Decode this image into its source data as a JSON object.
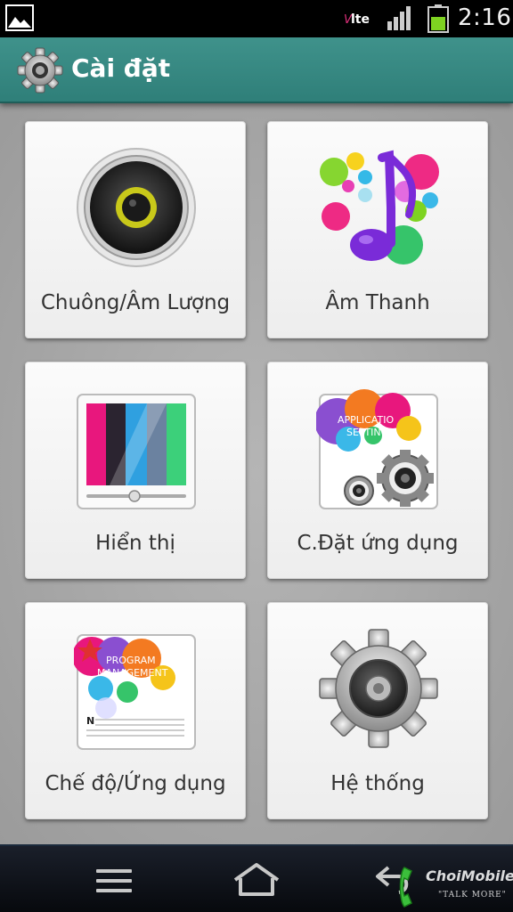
{
  "status_bar": {
    "network_badge": "Volte",
    "time": "2:16",
    "icons": [
      "gallery-icon",
      "volte-icon",
      "signal-icon",
      "battery-icon"
    ]
  },
  "header": {
    "title": "Cài đặt",
    "icon": "settings-gear-icon"
  },
  "tiles": [
    {
      "label": "Chuông/Âm Lượng",
      "icon": "speaker-icon"
    },
    {
      "label": "Âm Thanh",
      "icon": "music-note-icon"
    },
    {
      "label": "Hiển thị",
      "icon": "display-icon"
    },
    {
      "label": "C.Đặt ứng dụng",
      "icon": "application-settings-icon",
      "icon_text": "APPLICATION SETTINGS"
    },
    {
      "label": "Chế độ/Ứng dụng",
      "icon": "program-management-icon",
      "icon_text": "PROGRAM MANAGEMENT"
    },
    {
      "label": "Hệ thống",
      "icon": "system-gear-icon"
    }
  ],
  "nav_bar": {
    "icons": [
      "menu-icon",
      "home-icon",
      "back-icon"
    ]
  },
  "watermark": {
    "brand": "ChoiMobile",
    "tagline": "\"TALK MORE\""
  },
  "colors": {
    "header": "#3a8c86",
    "background": "#a8a8a8",
    "tile": "#f5f5f5",
    "nav": "#0b0e14"
  }
}
